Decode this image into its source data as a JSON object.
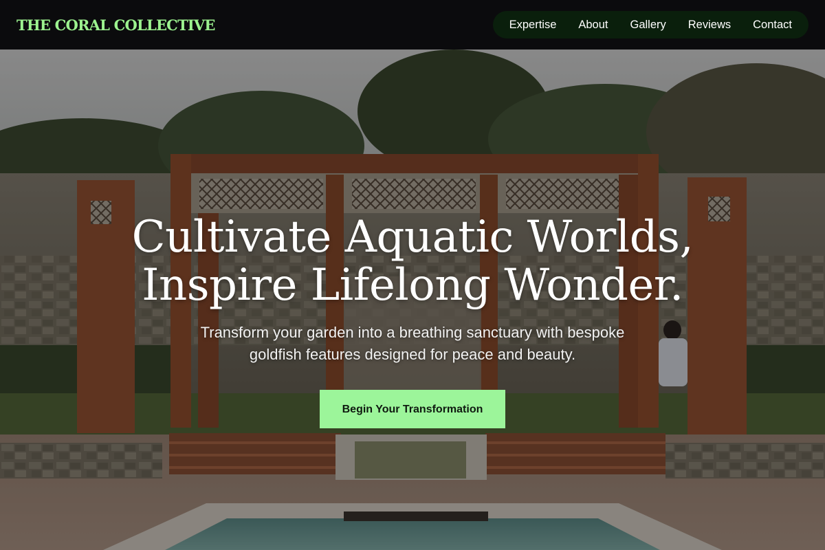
{
  "brand": {
    "name": "THE CORAL COLLECTIVE",
    "color": "#9cf28f"
  },
  "nav": {
    "items": [
      {
        "label": "Expertise"
      },
      {
        "label": "About"
      },
      {
        "label": "Gallery"
      },
      {
        "label": "Reviews"
      },
      {
        "label": "Contact"
      }
    ],
    "pill_color": "#0a1f0c"
  },
  "hero": {
    "headline_line1": "Cultivate Aquatic Worlds,",
    "headline_line2": "Inspire Lifelong Wonder.",
    "subtext": "Transform your garden into a breathing sanctuary with bespoke goldfish features designed for peace and beauty.",
    "cta_label": "Begin Your Transformation",
    "cta_color": "#9cf59a",
    "background_image": "garden courtyard with sandstone pavilion, lattice screens, steps and reflecting pool"
  }
}
